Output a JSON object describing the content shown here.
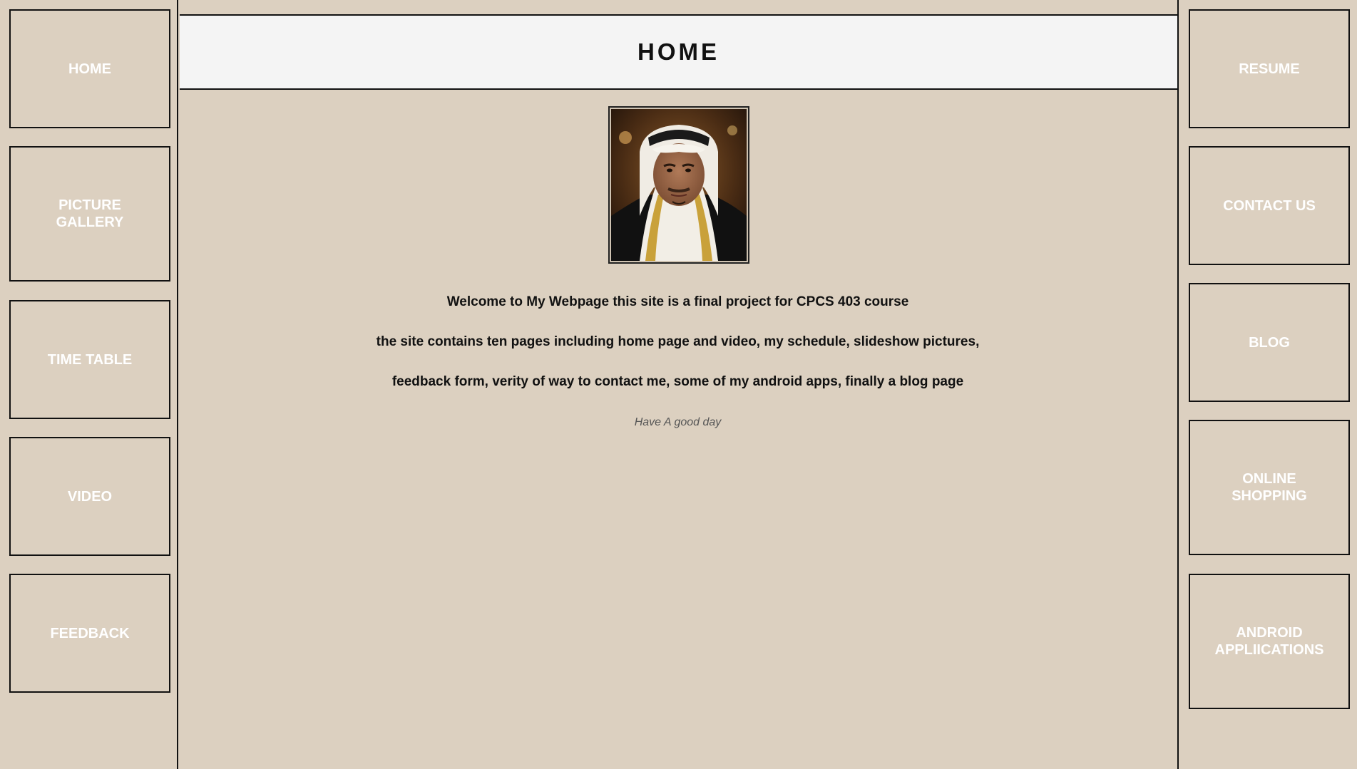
{
  "page": {
    "title": "HOME"
  },
  "nav_left": [
    {
      "label": "HOME"
    },
    {
      "label": "PICTURE GALLERY"
    },
    {
      "label": "TIME TABLE"
    },
    {
      "label": "VIDEO"
    },
    {
      "label": "FEEDBACK"
    }
  ],
  "nav_right": [
    {
      "label": "RESUME"
    },
    {
      "label": "CONTACT US"
    },
    {
      "label": "BLOG"
    },
    {
      "label": "ONLINE SHOPPING"
    },
    {
      "label": "ANDROID APPLIICATIONS"
    }
  ],
  "content": {
    "photo_icon": "profile-photo",
    "line1": "Welcome to My Webpage this site is a final project for CPCS 403 course",
    "line2": "the site contains ten pages including home page and video, my schedule, slideshow pictures,",
    "line3": "feedback form, verity of way to contact me, some of my android apps, finally a blog page",
    "signoff": "Have A good day"
  },
  "colors": {
    "background": "#dcd0c0",
    "header_background": "#f4f4f4",
    "border": "#111111",
    "nav_text": "#ffffff"
  }
}
